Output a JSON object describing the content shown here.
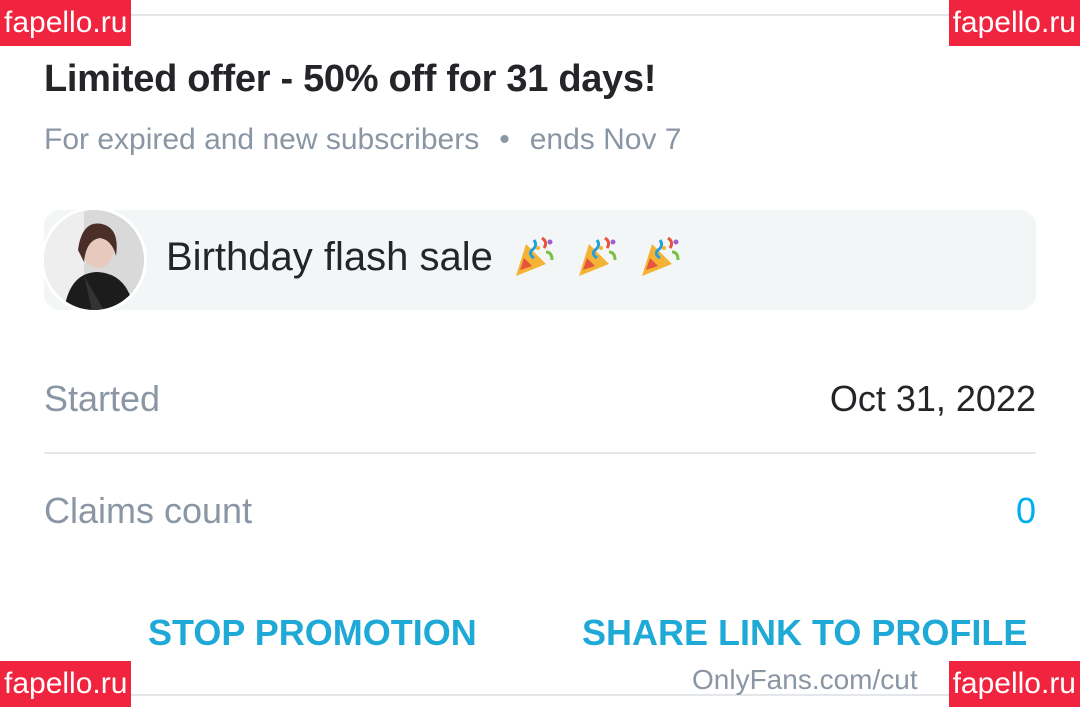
{
  "promotion": {
    "title": "Limited offer - 50% off for 31 days!",
    "audience": "For expired and new subscribers",
    "separator": "•",
    "ends": "ends Nov 7",
    "message": "Birthday flash sale",
    "message_emoji": "party-popper-icon"
  },
  "details": {
    "started_label": "Started",
    "started_value": "Oct 31, 2022",
    "claims_label": "Claims count",
    "claims_value": "0"
  },
  "actions": {
    "stop": "STOP PROMOTION",
    "share": "SHARE LINK TO PROFILE"
  },
  "footer": {
    "url": "OnlyFans.com/cut"
  },
  "watermark": {
    "text": "fapello.ru"
  },
  "colors": {
    "accent": "#00aff0",
    "action": "#1fa9d6",
    "watermark": "#f0243e",
    "muted": "#8a96a3"
  }
}
